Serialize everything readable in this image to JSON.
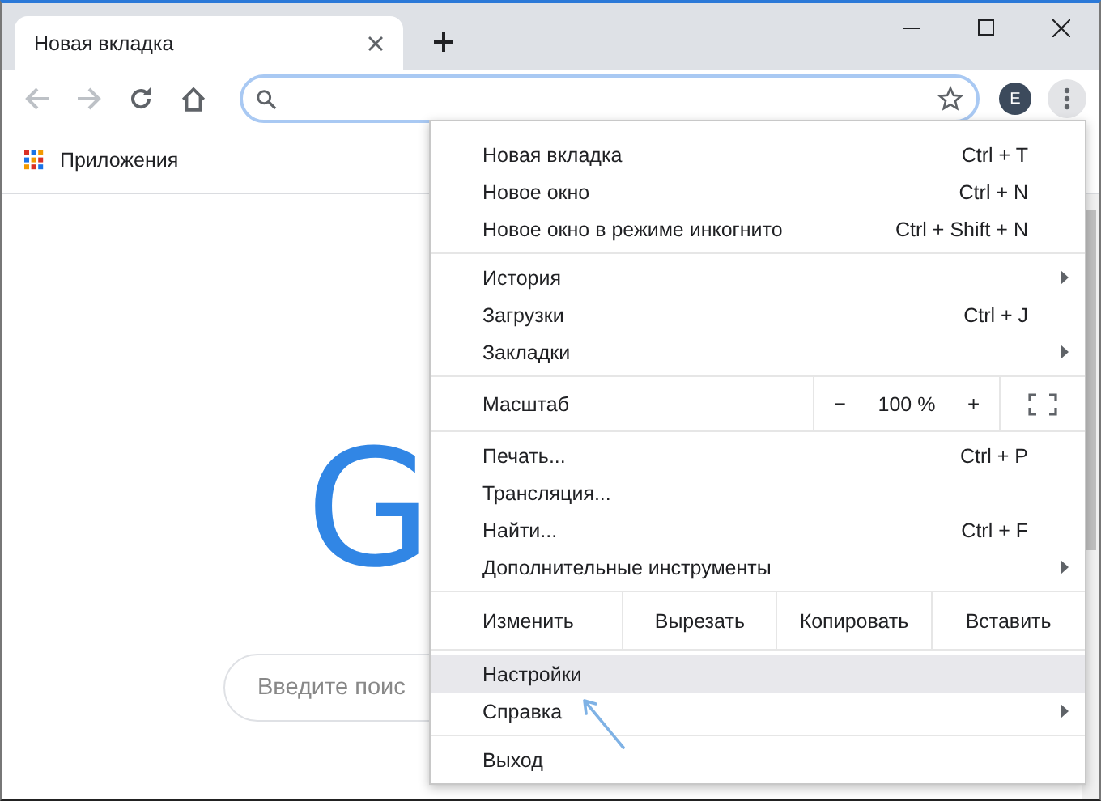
{
  "tabs": [
    {
      "label": "Новая вкладка",
      "selected": true
    }
  ],
  "profile": {
    "initial": "E"
  },
  "bookmarks": [
    {
      "label": "Приложения"
    }
  ],
  "page": {
    "logo": "G",
    "search_placeholder": "Введите поис"
  },
  "menu": {
    "groups": [
      [
        {
          "kind": "item",
          "label": "Новая вкладка",
          "shortcut": "Ctrl + T",
          "submenu": false,
          "selected": false
        },
        {
          "kind": "item",
          "label": "Новое окно",
          "shortcut": "Ctrl + N",
          "submenu": false,
          "selected": false
        },
        {
          "kind": "item",
          "label": "Новое окно в режиме инкогнито",
          "shortcut": "Ctrl + Shift + N",
          "submenu": false,
          "selected": false
        }
      ],
      [
        {
          "kind": "item",
          "label": "История",
          "submenu": true,
          "selected": false
        },
        {
          "kind": "item",
          "label": "Загрузки",
          "shortcut": "Ctrl + J",
          "submenu": false,
          "selected": false
        },
        {
          "kind": "item",
          "label": "Закладки",
          "submenu": true,
          "selected": false
        }
      ],
      [
        {
          "kind": "zoom",
          "label": "Масштаб",
          "minus": "−",
          "value": "100 %",
          "plus": "+"
        }
      ],
      [
        {
          "kind": "item",
          "label": "Печать...",
          "shortcut": "Ctrl + P",
          "submenu": false,
          "selected": false
        },
        {
          "kind": "item",
          "label": "Трансляция...",
          "submenu": false,
          "selected": false
        },
        {
          "kind": "item",
          "label": "Найти...",
          "shortcut": "Ctrl + F",
          "submenu": false,
          "selected": false
        },
        {
          "kind": "item",
          "label": "Дополнительные инструменты",
          "submenu": true,
          "selected": false
        }
      ],
      [
        {
          "kind": "edit",
          "label": "Изменить",
          "buttons": [
            "Вырезать",
            "Копировать",
            "Вставить"
          ]
        }
      ],
      [
        {
          "kind": "item",
          "label": "Настройки",
          "submenu": false,
          "selected": true
        },
        {
          "kind": "item",
          "label": "Справка",
          "submenu": true,
          "selected": false
        }
      ],
      [
        {
          "kind": "item",
          "label": "Выход",
          "submenu": false,
          "selected": false
        }
      ]
    ]
  }
}
